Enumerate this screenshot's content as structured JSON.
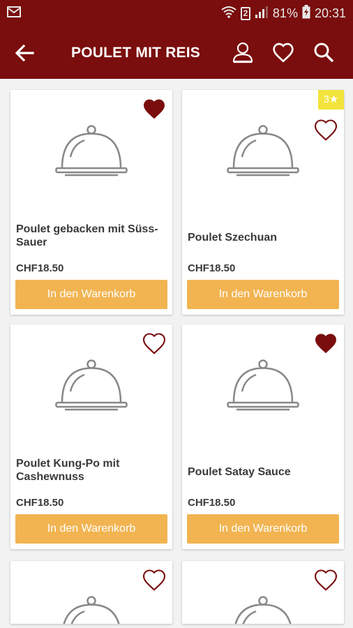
{
  "status_bar": {
    "battery": "81%",
    "time": "20:31",
    "sim": "2"
  },
  "app_bar": {
    "title": "POULET MIT REIS"
  },
  "colors": {
    "brand": "#7a0d0d",
    "button": "#f2b451",
    "rating_badge": "#f2e43c"
  },
  "products": [
    {
      "name": "Poulet gebacken mit Süss-Sauer",
      "price": "CHF18.50",
      "button": "In den Warenkorb",
      "favorite": true
    },
    {
      "name": "Poulet Szechuan",
      "price": "CHF18.50",
      "button": "In den Warenkorb",
      "favorite": false,
      "rating": "3★"
    },
    {
      "name": "Poulet Kung-Po mit Cashewnuss",
      "price": "CHF18.50",
      "button": "In den Warenkorb",
      "favorite": false
    },
    {
      "name": "Poulet Satay Sauce",
      "price": "CHF18.50",
      "button": "In den Warenkorb",
      "favorite": true
    },
    {
      "favorite": false
    },
    {
      "favorite": false
    }
  ]
}
